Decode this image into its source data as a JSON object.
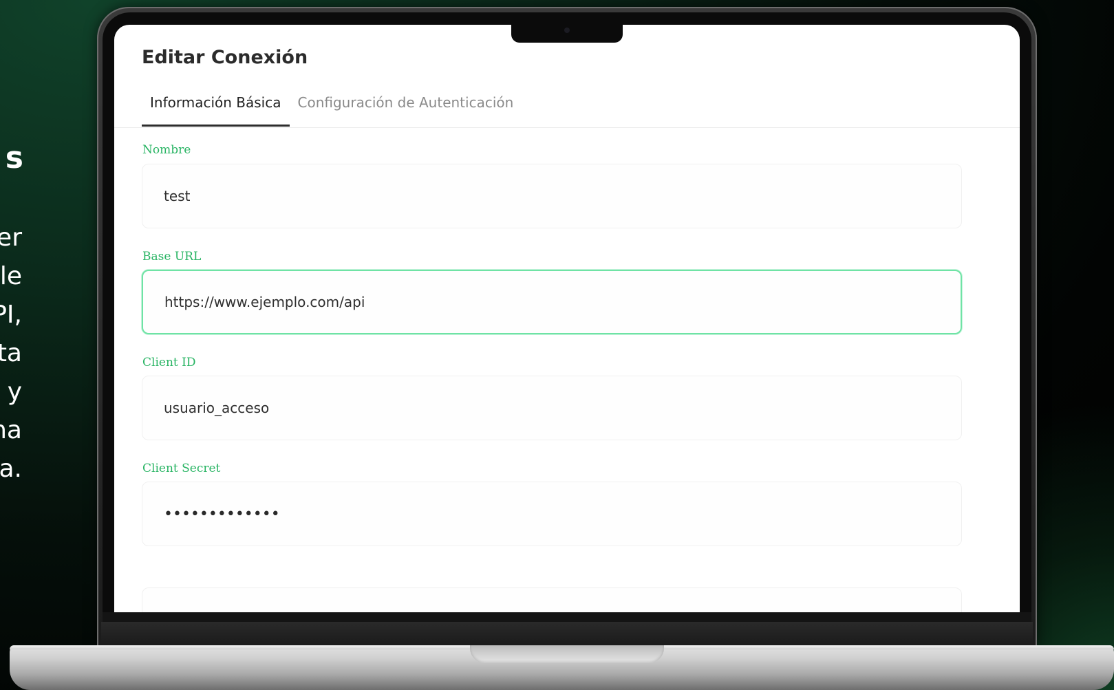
{
  "promo": {
    "heading_fragment": "s",
    "lines": [
      "er",
      "le",
      "PI,",
      "ta",
      "y",
      "na",
      "a."
    ]
  },
  "dialog": {
    "title": "Editar Conexión",
    "tabs": [
      {
        "label": "Información Básica",
        "active": true
      },
      {
        "label": "Configuración de Autenticación",
        "active": false
      }
    ]
  },
  "fields": {
    "nombre": {
      "label": "Nombre",
      "value": "test"
    },
    "base_url": {
      "label": "Base URL",
      "value": "https://www.ejemplo.com/api"
    },
    "client_id": {
      "label": "Client ID",
      "value": "usuario_acceso"
    },
    "client_secret": {
      "label": "Client Secret",
      "value": "•••••••••••••"
    }
  },
  "colors": {
    "label_green": "#28b463",
    "focus_border": "#6fe3a5",
    "background_dark_green": "#0b2a1b"
  }
}
